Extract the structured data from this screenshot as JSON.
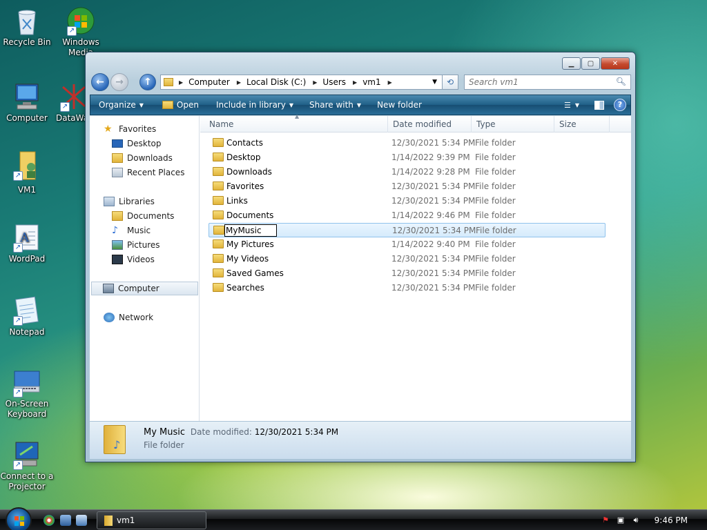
{
  "desktop": {
    "icons": [
      {
        "label": "Recycle Bin"
      },
      {
        "label": "Windows Media Center"
      },
      {
        "label": "Computer"
      },
      {
        "label": "DataWa"
      },
      {
        "label": "VM1"
      },
      {
        "label": "WordPad"
      },
      {
        "label": "Notepad"
      },
      {
        "label": "On-Screen Keyboard"
      },
      {
        "label": "Connect to a Projector"
      }
    ]
  },
  "window": {
    "address": {
      "crumbs": [
        "Computer",
        "Local Disk (C:)",
        "Users",
        "vm1"
      ]
    },
    "search": {
      "placeholder": "Search vm1"
    },
    "toolbar": {
      "organize": "Organize",
      "open": "Open",
      "include_in_library": "Include in library",
      "share_with": "Share with",
      "new_folder": "New folder"
    },
    "nav": {
      "favorites": "Favorites",
      "favorites_items": [
        "Desktop",
        "Downloads",
        "Recent Places"
      ],
      "libraries": "Libraries",
      "libraries_items": [
        "Documents",
        "Music",
        "Pictures",
        "Videos"
      ],
      "computer": "Computer",
      "network": "Network"
    },
    "columns": {
      "name": "Name",
      "date": "Date modified",
      "type": "Type",
      "size": "Size"
    },
    "files": [
      {
        "name": "Contacts",
        "date": "12/30/2021 5:34 PM",
        "type": "File folder"
      },
      {
        "name": "Desktop",
        "date": "1/14/2022 9:39 PM",
        "type": "File folder"
      },
      {
        "name": "Downloads",
        "date": "1/14/2022 9:28 PM",
        "type": "File folder"
      },
      {
        "name": "Favorites",
        "date": "12/30/2021 5:34 PM",
        "type": "File folder"
      },
      {
        "name": "Links",
        "date": "12/30/2021 5:34 PM",
        "type": "File folder"
      },
      {
        "name": "Documents",
        "date": "1/14/2022 9:46 PM",
        "type": "File folder"
      },
      {
        "name": "MyMusic",
        "date": "12/30/2021 5:34 PM",
        "type": "File folder"
      },
      {
        "name": "My Pictures",
        "date": "1/14/2022 9:40 PM",
        "type": "File folder"
      },
      {
        "name": "My Videos",
        "date": "12/30/2021 5:34 PM",
        "type": "File folder"
      },
      {
        "name": "Saved Games",
        "date": "12/30/2021 5:34 PM",
        "type": "File folder"
      },
      {
        "name": "Searches",
        "date": "12/30/2021 5:34 PM",
        "type": "File folder"
      }
    ],
    "rename_value": "MyMusic",
    "details": {
      "name": "My Music",
      "date_label": "Date modified:",
      "date_value": "12/30/2021 5:34 PM",
      "type": "File folder"
    }
  },
  "taskbar": {
    "task_label": "vm1",
    "clock": "9:46 PM"
  },
  "colors": {
    "accent": "#1f5f87",
    "selection": "#d5ebfc"
  }
}
